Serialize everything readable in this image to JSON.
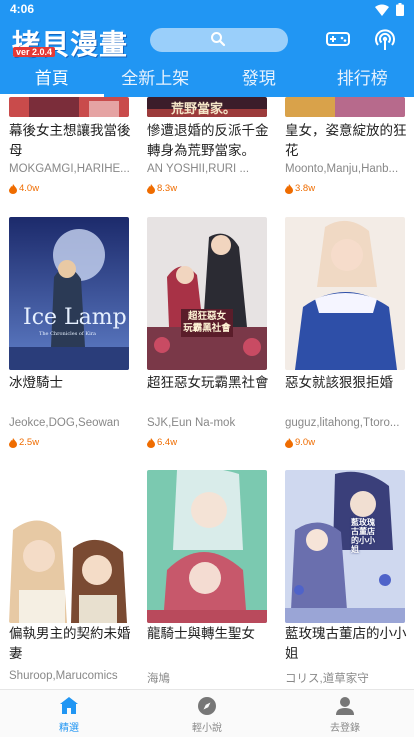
{
  "status_bar": {
    "time": "4:06"
  },
  "app_bar": {
    "logo": "拷貝漫畫",
    "version": "ver 2.0.4"
  },
  "tabs": [
    {
      "label": "首頁",
      "active": true
    },
    {
      "label": "全新上架",
      "active": false
    },
    {
      "label": "發現",
      "active": false
    },
    {
      "label": "排行榜",
      "active": false
    }
  ],
  "comics": [
    {
      "title": "幕後女主想讓我當後母",
      "authors": "MOKGAMGI,HARIHE...",
      "popularity": "4.0w",
      "cover_colors": [
        "#c94b4b",
        "#7b2d3a"
      ]
    },
    {
      "title": "慘遭退婚的反派千金轉身為荒野當家。",
      "authors": "AN YOSHII,RURI ...",
      "popularity": "8.3w",
      "cover_colors": [
        "#9c3b3b",
        "#3b1d2a"
      ],
      "cover_text": "荒野當家。"
    },
    {
      "title": "皇女，姿意綻放的狂花",
      "authors": "Moonto,Manju,Hanb...",
      "popularity": "3.8w",
      "cover_colors": [
        "#d9a24a",
        "#b76a8c"
      ]
    },
    {
      "title": "冰燈騎士",
      "authors": "Jeokce,DOG,Seowan",
      "popularity": "2.5w",
      "cover_colors": [
        "#1c2a6b",
        "#5f7ec7"
      ],
      "cover_text": "Ice Lamp",
      "cover_subtext": "The Chronicles of Kira"
    },
    {
      "title": "超狂惡女玩霸黑社會",
      "authors": "SJK,Eun Na-mok",
      "popularity": "6.4w",
      "cover_colors": [
        "#2b2b33",
        "#a83246"
      ],
      "cover_text": "超狂惡女 玩霸黑社會"
    },
    {
      "title": "惡女就該狠狠拒婚",
      "authors": "guguz,litahong,Ttoro...",
      "popularity": "9.0w",
      "cover_colors": [
        "#f0d9c4",
        "#2e4fa8"
      ]
    },
    {
      "title": "偏執男主的契約未婚妻",
      "authors": "Shuroop,Marucomics",
      "popularity": "",
      "cover_colors": [
        "#fbf8f3",
        "#e7c9a4"
      ]
    },
    {
      "title": "龍騎士與轉生聖女",
      "authors": "海鳩",
      "popularity": "",
      "cover_colors": [
        "#7bc9b0",
        "#c7586b"
      ]
    },
    {
      "title": "藍玫瑰古董店的小小姐",
      "authors": "コリス,道草家守",
      "popularity": "",
      "cover_colors": [
        "#cfd8ef",
        "#3a3f7a"
      ],
      "cover_text": "藍玫瑰古董店的小小姐"
    }
  ],
  "bottom_nav": [
    {
      "label": "精選",
      "icon": "home-icon",
      "active": true
    },
    {
      "label": "輕小說",
      "icon": "compass-icon",
      "active": false
    },
    {
      "label": "去登錄",
      "icon": "person-icon",
      "active": false
    }
  ],
  "colors": {
    "primary": "#2196f3",
    "popularity": "#ef6c00",
    "version_badge": "#e53935"
  }
}
